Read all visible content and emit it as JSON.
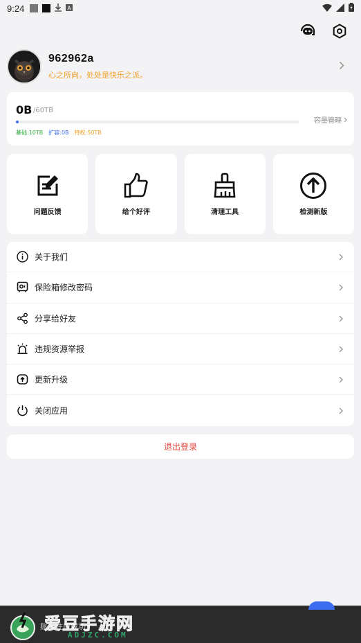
{
  "status_bar": {
    "time": "9:24",
    "left_icons": [
      "gray-square-icon",
      "black-square-icon",
      "download-icon",
      "a-badge-icon"
    ],
    "right_icons": [
      "wifi-icon",
      "signal-icon",
      "battery-icon"
    ]
  },
  "header": {
    "icons": [
      "robot-chat-icon",
      "settings-hex-icon"
    ]
  },
  "profile": {
    "username": "962962a",
    "motto": "心之所向，处处是快乐之派。",
    "avatar_icon": "owl-avatar-icon"
  },
  "storage": {
    "used": "0B",
    "total": "/60TB",
    "progress_fraction": 0.01,
    "manage_label": "容量管理",
    "legend": [
      {
        "label": "基础:10TB",
        "color": "#2fae3e"
      },
      {
        "label": "扩容:0B",
        "color": "#3c6cf0"
      },
      {
        "label": "特权:50TB",
        "color": "#f0a12a"
      }
    ]
  },
  "tiles": [
    {
      "label": "问题反馈",
      "icon": "feedback-edit-icon"
    },
    {
      "label": "给个好评",
      "icon": "thumbs-up-icon"
    },
    {
      "label": "清理工具",
      "icon": "broom-icon"
    },
    {
      "label": "检测新版",
      "icon": "upload-circle-icon"
    }
  ],
  "menu": [
    {
      "label": "关于我们",
      "icon": "info-icon"
    },
    {
      "label": "保险箱修改密码",
      "icon": "safe-icon"
    },
    {
      "label": "分享给好友",
      "icon": "share-icon"
    },
    {
      "label": "违规资源举报",
      "icon": "alarm-light-icon"
    },
    {
      "label": "更新升级",
      "icon": "update-icon"
    },
    {
      "label": "关闭应用",
      "icon": "power-icon"
    }
  ],
  "logout": {
    "label": "退出登录"
  },
  "watermark": {
    "title": "爱豆手游网",
    "subtitle": "ADJZC.COM",
    "underlying_text": "账号注册成功"
  }
}
